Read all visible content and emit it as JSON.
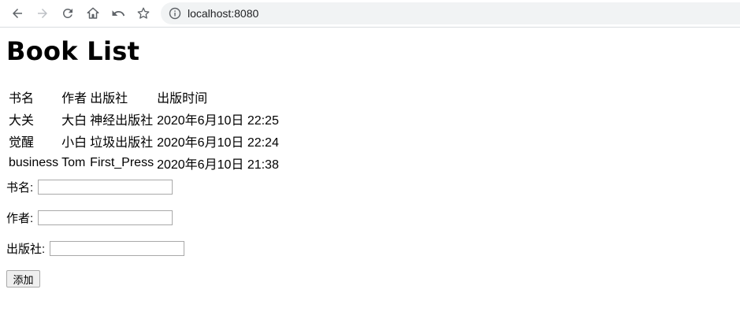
{
  "browser": {
    "url": "localhost:8080",
    "icons": [
      "back-icon",
      "forward-icon",
      "reload-icon",
      "home-icon",
      "undo-icon",
      "bookmark-star-icon",
      "info-icon"
    ]
  },
  "page": {
    "title": "Book List",
    "table": {
      "headers": [
        "书名",
        "作者",
        "出版社",
        "出版时间"
      ],
      "rows": [
        [
          "大关",
          "大白",
          "神经出版社",
          "2020年6月10日 22:25"
        ],
        [
          "觉醒",
          "小白",
          "垃圾出版社",
          "2020年6月10日 22:24"
        ],
        [
          "business",
          "Tom",
          "First_Press",
          "2020年6月10日 21:38"
        ]
      ]
    },
    "form": {
      "title_label": "书名:",
      "author_label": "作者:",
      "publisher_label": "出版社:",
      "title_value": "",
      "author_value": "",
      "publisher_value": "",
      "submit_label": "添加"
    }
  }
}
